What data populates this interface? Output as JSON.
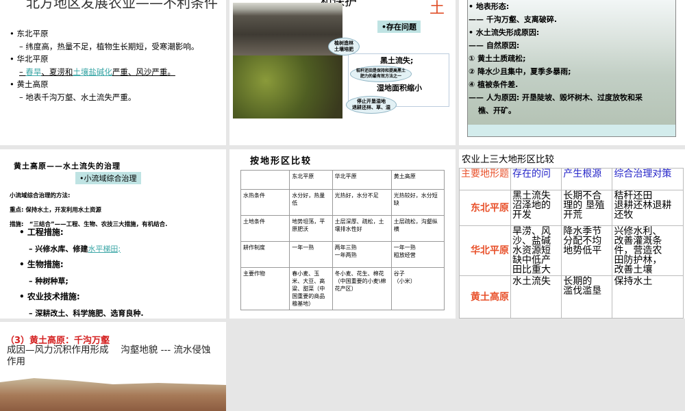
{
  "slide1": {
    "title": "北方地区发展农业——不利条件",
    "items": [
      {
        "head": "东北平原",
        "sub": "– 纬度高，热量不足，植物生长期短，受寒潮影响。"
      },
      {
        "head": "华北平原",
        "sub_parts": [
          "– ",
          "春旱",
          "、夏涝和",
          "土壤盐碱化",
          "严重、风沙严重。"
        ]
      },
      {
        "head": "黄土高原",
        "sub": "– 地表千沟万壑、水土流失严重。"
      }
    ]
  },
  "slide2": {
    "title_partial": "和保护",
    "title_red": "土",
    "tag": "•存在问题",
    "cloud1": "植树造林\n土壤培肥",
    "text1": "黑土流失;",
    "cloud2": "秸秆还田是保持和提高黑土\n肥力的最有效方法之一",
    "text2": "湿地面积缩小",
    "cloud3": "停止开垦湿地\n退耕还林、草、湿"
  },
  "slide3": {
    "lines": [
      "• 地表形态:",
      "—— 千沟万壑、支离破碎.",
      "• 水土流失形成原因:",
      "—— 自然原因:",
      "① 黄土土质疏松;",
      "② 降水少且集中，夏季多暴雨;",
      "④ 植被条件差.",
      "—— 人为原因: 开垦陡坡、毁坏树木、过度放牧和采",
      "樵、开矿。"
    ]
  },
  "slide4": {
    "title": "黄土高原——水土流失的治理",
    "tag": "•小流域综合治理",
    "l1": "小流域综合治理的方法:",
    "l2": "重点: 保持水土，开发利用水土资源",
    "l3": "措施:　“三结合”——工程、生物、农技三大措施，有机结合.",
    "b1": "工程措施:",
    "s1a": "– 兴修水库、修建",
    "s1b": "水平梯田;",
    "b2": "生物措施:",
    "s2": "– 种树种草;",
    "b3": "农业技术措施:",
    "s3": "– 深耕改土、科学施肥、选育良种."
  },
  "slide5": {
    "title": "按地形区比较",
    "table": [
      [
        "",
        "东北平原",
        "华北平原",
        "黄土高原"
      ],
      [
        "水热条件",
        "水分好，热量低",
        "光热好，水分不足",
        "光热较好，水分短缺"
      ],
      [
        "土地条件",
        "地势坦荡，平原肥沃",
        "土层深厚、疏松，土壤排水性好",
        "土层疏松，沟壑纵横"
      ],
      [
        "耕作制度",
        "一年一熟",
        "两年三熟\n一年两熟",
        "一年一熟\n粗放经营"
      ],
      [
        "主要作物",
        "春小麦、玉米、大豆、高粱、甜菜（中国重要的商品粮基地）",
        "冬小麦、花生、棉花（中国重要的小麦\\棉花产区）",
        "谷子\n（小米）"
      ]
    ]
  },
  "slide6": {
    "title": "农业上三大地形区比较",
    "headers": [
      "主要地形题",
      "存在的问",
      "产生根源",
      "综合治理对策"
    ],
    "rows": [
      [
        "东北平原",
        "黑土流失\n沼泽地的\n开发",
        "长期不合\n理的 垦殖\n开荒",
        "秸秆还田\n退耕还林退耕\n还牧"
      ],
      [
        "华北平原",
        "旱涝、风\n沙、盐碱\n水资源短\n缺中低产\n田比重大",
        "降水季节\n分配不均\n地势低平",
        "兴修水利、\n改善灌溉条\n件，营造农\n田防护林，\n改善土壤"
      ],
      [
        "黄土高原",
        "水土流失",
        "长期的\n滥伐滥垦",
        "保持水土"
      ]
    ],
    "colors": {
      "region": "#e8502a",
      "header": "#2424c8"
    }
  },
  "slide7": {
    "title": "（3）黄土高原：千沟万壑",
    "body": "成因—风力沉积作用形成　 沟壑地貌 --- 流水侵蚀作用"
  }
}
